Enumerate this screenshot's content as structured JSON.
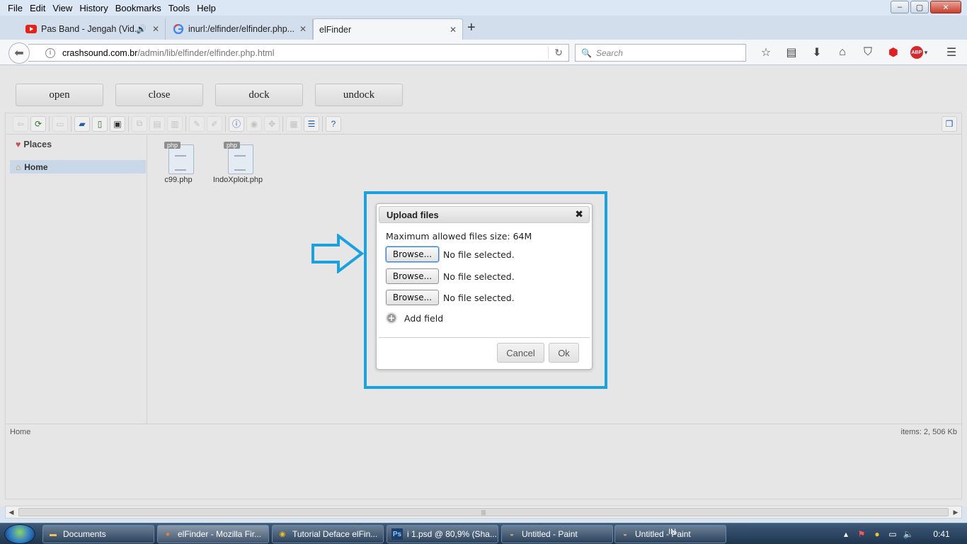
{
  "menu": [
    "File",
    "Edit",
    "View",
    "History",
    "Bookmarks",
    "Tools",
    "Help"
  ],
  "window_controls": {
    "minimize": "–",
    "maximize": "▢",
    "close": "✕"
  },
  "tabs": [
    {
      "label": "Pas Band - Jengah (Vid...",
      "icon": "youtube-icon"
    },
    {
      "label": "inurl:/elfinder/elfinder.php...",
      "icon": "google-icon"
    },
    {
      "label": "elFinder",
      "icon": "none"
    }
  ],
  "new_tab": "+",
  "address": {
    "host": "crashsound.com.br",
    "path": "/admin/lib/elfinder/elfinder.php.html"
  },
  "search": {
    "placeholder": "Search"
  },
  "page_buttons": [
    "open",
    "close",
    "dock",
    "undock"
  ],
  "places_label": "Places",
  "home_label": "Home",
  "files": [
    {
      "name": "c99.php",
      "type": "php"
    },
    {
      "name": "IndoXploit.php",
      "type": "php"
    }
  ],
  "status": {
    "path": "Home",
    "items": "items: 2, 506 Kb"
  },
  "dialog": {
    "title": "Upload files",
    "close": "✖",
    "max_size": "Maximum allowed files size: 64M",
    "fields": [
      {
        "button": "Browse...",
        "status": "No file selected."
      },
      {
        "button": "Browse...",
        "status": "No file selected."
      },
      {
        "button": "Browse...",
        "status": "No file selected."
      }
    ],
    "add_field": "Add field",
    "cancel": "Cancel",
    "ok": "Ok"
  },
  "highlight_color": "#1aa1e0",
  "taskbar": {
    "tasks": [
      {
        "label": "Documents",
        "icon": "folder-icon"
      },
      {
        "label": "elFinder - Mozilla Fir...",
        "icon": "firefox-icon"
      },
      {
        "label": "Tutorial Deface elFin...",
        "icon": "chrome-icon"
      },
      {
        "label": "i 1.psd @ 80,9% (Sha...",
        "icon": "photoshop-icon"
      },
      {
        "label": "Untitled - Paint",
        "icon": "paint-icon"
      },
      {
        "label": "Untitled - Paint",
        "icon": "paint-icon"
      }
    ],
    "lang": "IN",
    "clock": "0:41"
  }
}
